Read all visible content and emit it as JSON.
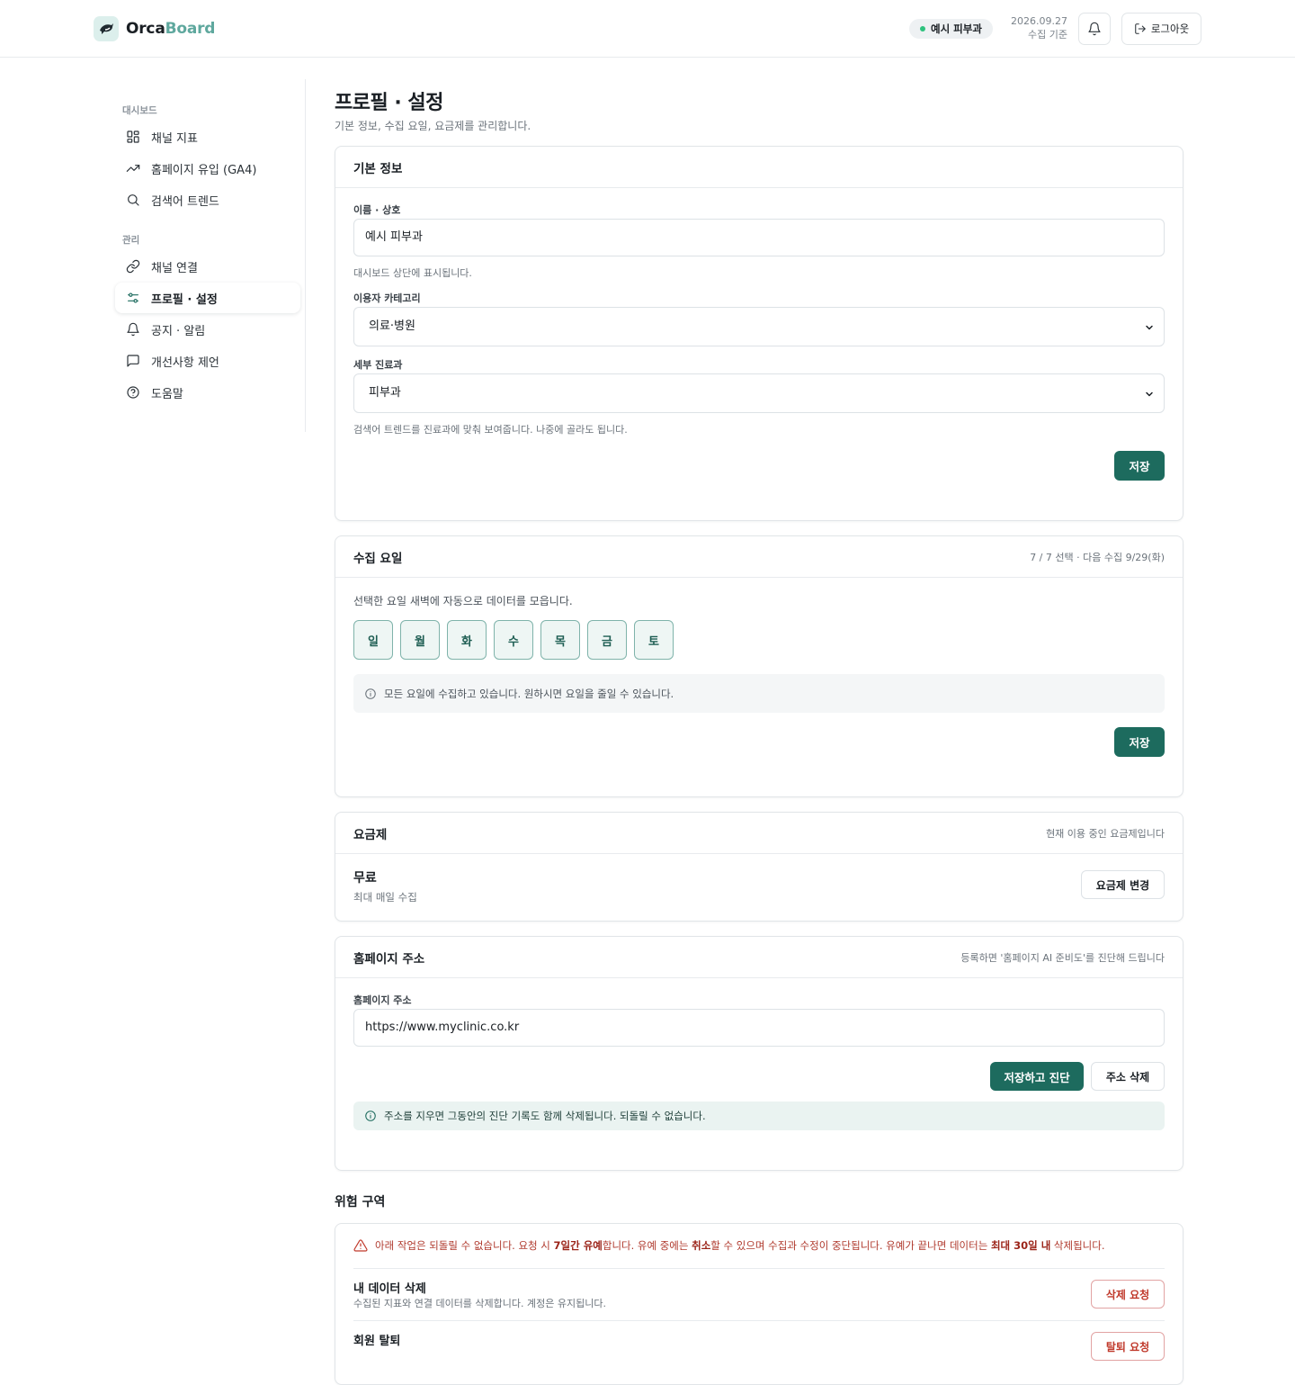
{
  "app": {
    "logo_a": "Orca",
    "logo_b": "Board",
    "org_name": "예시 피부과",
    "date": "2026.09.27",
    "date_caption": "수집 기준",
    "logout_label": "로그아웃"
  },
  "sidebar": {
    "section_dashboard": "대시보드",
    "section_manage": "관리",
    "items": [
      {
        "label": "채널 지표",
        "icon": "grid-icon"
      },
      {
        "label": "홈페이지 유입 (GA4)",
        "icon": "trend-up-icon"
      },
      {
        "label": "검색어 트렌드",
        "icon": "search-icon"
      },
      {
        "label": "채널 연결",
        "icon": "link-icon"
      },
      {
        "label": "프로필 · 설정",
        "icon": "sliders-icon",
        "active": true
      },
      {
        "label": "공지 · 알림",
        "icon": "bell-icon"
      },
      {
        "label": "개선사항 제언",
        "icon": "message-icon"
      },
      {
        "label": "도움말",
        "icon": "help-circle-icon"
      }
    ]
  },
  "page": {
    "title": "프로필 · 설정",
    "subtitle": "기본 정보, 수집 요일, 요금제를 관리합니다."
  },
  "basic": {
    "title": "기본 정보",
    "name_label": "이름 · 상호",
    "name_value": "예시 피부과",
    "name_help": "대시보드 상단에 표시됩니다.",
    "category_label": "이용자 카테고리",
    "category_value": "의료·병원",
    "dept_label": "세부 진료과",
    "dept_value": "피부과",
    "dept_help": "검색어 트렌드를 진료과에 맞춰 보여줍니다. 나중에 골라도 됩니다.",
    "save_label": "저장"
  },
  "schedule": {
    "title": "수집 요일",
    "meta": "7 / 7 선택 · 다음 수집 9/29(화)",
    "desc": "선택한 요일 새벽에 자동으로 데이터를 모읍니다.",
    "days": [
      "일",
      "월",
      "화",
      "수",
      "목",
      "금",
      "토"
    ],
    "note": "모든 요일에 수집하고 있습니다. 원하시면 요일을 줄일 수 있습니다.",
    "save_label": "저장"
  },
  "plan": {
    "title": "요금제",
    "meta": "현재 이용 중인 요금제입니다",
    "name": "무료",
    "desc": "최대 매일 수집",
    "change_label": "요금제 변경"
  },
  "homepage": {
    "title": "홈페이지 주소",
    "meta": "등록하면 '홈페이지 AI 준비도'를 진단해 드립니다",
    "url_label": "홈페이지 주소",
    "url_value": "https://www.myclinic.co.kr",
    "save_diag_label": "저장하고 진단",
    "delete_label": "주소 삭제",
    "note": "주소를 지우면 그동안의 진단 기록도 함께 삭제됩니다. 되돌릴 수 없습니다."
  },
  "danger": {
    "title": "위험 구역",
    "warn_1": "아래 작업은 되돌릴 수 없습니다. 요청 시 ",
    "warn_b1": "7일간 유예",
    "warn_2": "합니다. 유예 중에는 ",
    "warn_b2": "취소",
    "warn_3": "할 수 있으며 수집과 수정이 중단됩니다. 유예가 끝나면 데이터는 ",
    "warn_b3": "최대 30일 내",
    "warn_4": " 삭제됩니다.",
    "delete_data_title": "내 데이터 삭제",
    "delete_data_desc": "수집된 지표와 연결 데이터를 삭제합니다. 계정은 유지됩니다.",
    "delete_data_btn": "삭제 요청",
    "withdraw_title": "회원 탈퇴",
    "withdraw_btn": "탈퇴 요청"
  },
  "colors": {
    "primary": "#1d6b5e",
    "accent": "#5fa89e",
    "danger": "#c0392b"
  }
}
